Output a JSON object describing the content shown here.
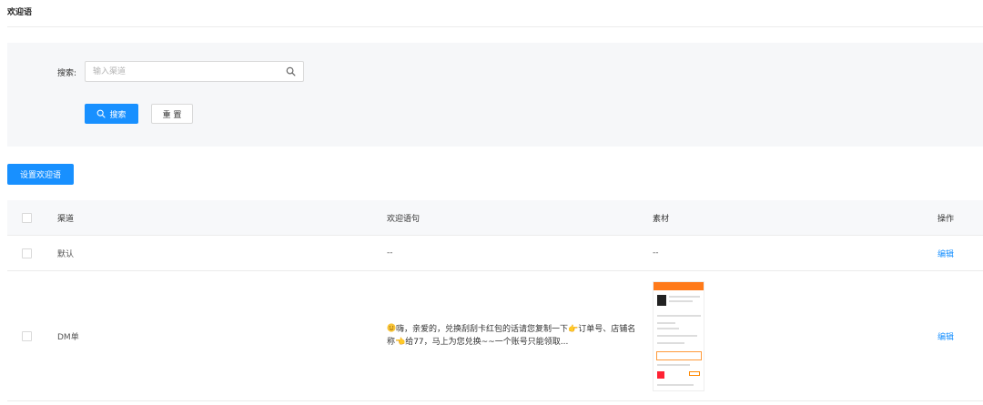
{
  "page": {
    "title": "欢迎语"
  },
  "search": {
    "label": "搜索:",
    "placeholder": "输入渠道",
    "search_button": "搜索",
    "reset_button": "重 置"
  },
  "toolbar": {
    "set_button": "设置欢迎语"
  },
  "table": {
    "headers": {
      "channel": "渠道",
      "message": "欢迎语句",
      "material": "素材",
      "operation": "操作"
    },
    "rows": [
      {
        "channel": "默认",
        "message": "--",
        "material": "--",
        "operation": "编辑"
      },
      {
        "channel": "DM单",
        "message": "嗨，亲爱的，兑换刮刮卡红包的话请您复制一下👉订单号、店铺名称👈给77，马上为您兑换~~一个账号只能领取...",
        "material": "",
        "operation": "编辑"
      }
    ]
  },
  "colors": {
    "primary": "#1890ff",
    "panel_bg": "#f6f7f9",
    "border": "#d9d9d9"
  }
}
